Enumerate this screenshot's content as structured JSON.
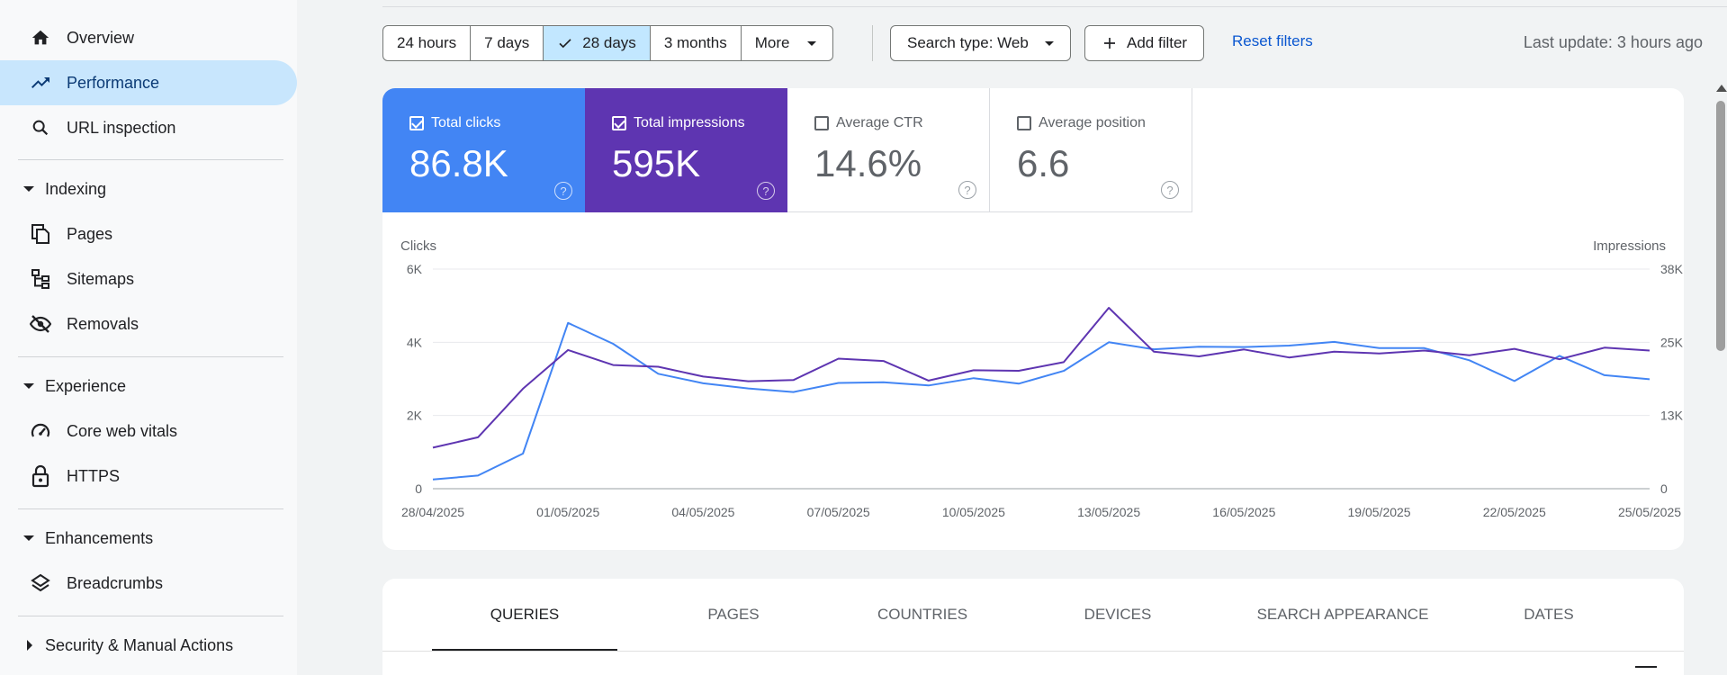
{
  "sidebar": {
    "overview": "Overview",
    "performance": "Performance",
    "url_inspection": "URL inspection",
    "indexing": "Indexing",
    "pages": "Pages",
    "sitemaps": "Sitemaps",
    "removals": "Removals",
    "experience": "Experience",
    "core_web_vitals": "Core web vitals",
    "https": "HTTPS",
    "enhancements": "Enhancements",
    "breadcrumbs": "Breadcrumbs",
    "security": "Security & Manual Actions"
  },
  "toolbar": {
    "ranges": [
      "24 hours",
      "7 days",
      "28 days",
      "3 months",
      "More"
    ],
    "selected_range": "28 days",
    "search_type": "Search type: Web",
    "add_filter": "Add filter",
    "reset_filters": "Reset filters",
    "last_update": "Last update: 3 hours ago"
  },
  "metrics": {
    "clicks": {
      "label": "Total clicks",
      "value": "86.8K",
      "checked": true,
      "color": "#4285f4"
    },
    "impressions": {
      "label": "Total impressions",
      "value": "595K",
      "checked": true,
      "color": "#5e35b1"
    },
    "ctr": {
      "label": "Average CTR",
      "value": "14.6%",
      "checked": false
    },
    "position": {
      "label": "Average position",
      "value": "6.6",
      "checked": false
    }
  },
  "tabs": [
    "QUERIES",
    "PAGES",
    "COUNTRIES",
    "DEVICES",
    "SEARCH APPEARANCE",
    "DATES"
  ],
  "active_tab": "QUERIES",
  "chart_data": {
    "type": "line",
    "y_left_label": "Clicks",
    "y_right_label": "Impressions",
    "y_left_ticks": [
      "0",
      "2K",
      "4K",
      "6K"
    ],
    "y_right_ticks": [
      "0",
      "13K",
      "25K",
      "38K"
    ],
    "ylim_left": [
      0,
      6000
    ],
    "ylim_right": [
      0,
      38000
    ],
    "x_tick_labels": [
      "28/04/2025",
      "01/05/2025",
      "04/05/2025",
      "07/05/2025",
      "10/05/2025",
      "13/05/2025",
      "16/05/2025",
      "19/05/2025",
      "22/05/2025",
      "25/05/2025"
    ],
    "x": [
      "28/04/2025",
      "29/04/2025",
      "30/04/2025",
      "01/05/2025",
      "02/05/2025",
      "03/05/2025",
      "04/05/2025",
      "05/05/2025",
      "06/05/2025",
      "07/05/2025",
      "08/05/2025",
      "09/05/2025",
      "10/05/2025",
      "11/05/2025",
      "12/05/2025",
      "13/05/2025",
      "14/05/2025",
      "15/05/2025",
      "16/05/2025",
      "17/05/2025",
      "18/05/2025",
      "19/05/2025",
      "20/05/2025",
      "21/05/2025",
      "22/05/2025",
      "23/05/2025",
      "24/05/2025",
      "25/05/2025"
    ],
    "series": [
      {
        "name": "Total clicks",
        "axis": "left",
        "color": "#4285f4",
        "values": [
          250,
          360,
          960,
          4530,
          3960,
          3140,
          2880,
          2740,
          2640,
          2890,
          2910,
          2820,
          3020,
          2870,
          3220,
          4000,
          3810,
          3880,
          3870,
          3910,
          4010,
          3840,
          3840,
          3510,
          2940,
          3630,
          3100,
          2990
        ]
      },
      {
        "name": "Total impressions",
        "axis": "right",
        "color": "#5e35b1",
        "values": [
          7100,
          8900,
          17300,
          24000,
          21400,
          21100,
          19400,
          18600,
          18800,
          22500,
          22100,
          18700,
          20500,
          20400,
          21900,
          31300,
          23700,
          22900,
          24100,
          22700,
          23700,
          23400,
          23900,
          23100,
          24200,
          22400,
          24400,
          23900
        ]
      }
    ]
  }
}
